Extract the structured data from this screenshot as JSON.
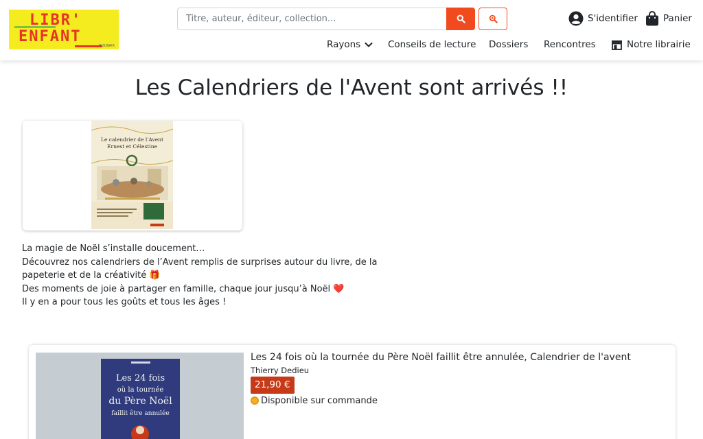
{
  "header": {
    "logo": {
      "line1": "LIBR'",
      "line2": "ENFANT",
      "sub": "ROUBAIX"
    },
    "search": {
      "placeholder": "Titre, auteur, éditeur, collection...",
      "value": ""
    },
    "account_label": "S'identifier",
    "cart_label": "Panier",
    "nav": [
      {
        "label": "Rayons",
        "icon": "chevron-down-icon"
      },
      {
        "label": "Conseils de lecture"
      },
      {
        "label": "Dossiers"
      },
      {
        "label": "Rencontres"
      },
      {
        "label": "Notre librairie",
        "icon": "store-icon"
      }
    ]
  },
  "main": {
    "title": "Les Calendriers de l'Avent sont arrivés !!",
    "feature_cover": {
      "line1": "Le calendrier de l'Avent",
      "line2": "Ernest et Célestine"
    },
    "intro": [
      "La magie de Noël s’installe doucement…",
      "Découvrez nos calendriers de l’Avent remplis de surprises autour du livre, de la papeterie et de la créativité 🎁",
      "Des moments de joie à partager en famille, chaque jour jusqu’à Noël ❤️",
      "Il y en a pour tous les goûts et tous les âges !"
    ],
    "product": {
      "title": "Les 24 fois où la tournée du Père Noël faillit être annulée, Calendrier de l'avent",
      "author": "Thierry Dedieu",
      "price": "21,90 €",
      "availability": "Disponible sur commande",
      "cover_text": [
        "Les 24 fois",
        "où la tournée",
        "du Père Noël",
        "faillit être annulée"
      ]
    }
  },
  "colors": {
    "accent": "#f24a1f",
    "price_bg": "#c73a18",
    "logo_bg": "#f4ec1e",
    "logo_text": "#e8332a",
    "availability": "#f5b025"
  }
}
